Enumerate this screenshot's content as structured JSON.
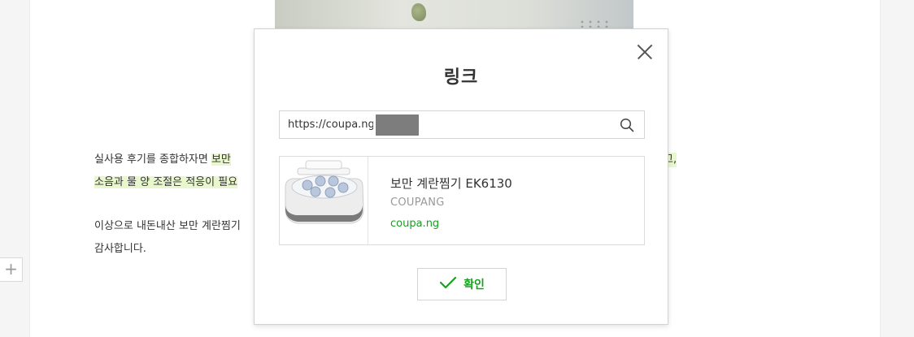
{
  "post": {
    "line1_prefix": "실사용 후기를 종합하자면 ",
    "line1_highlight": "보만 ",
    "line1_suffix_highlight": "고,",
    "line2_highlight": "소음과 물 양 조절은 적응이 필요",
    "line3": "이상으로 내돈내산 보만 계란찜기",
    "line4": "감사합니다."
  },
  "editor": {
    "add_label": "+"
  },
  "link_dialog": {
    "title": "링크",
    "url_value": "https://coupa.ng/",
    "preview": {
      "title": "보만 계란찜기 EK6130",
      "source": "COUPANG",
      "domain": "coupa.ng"
    },
    "confirm_label": "확인"
  },
  "colors": {
    "accent_green": "#17a11f",
    "highlight": "#e9f7cf"
  },
  "icons": [
    "close-icon",
    "search-icon",
    "check-icon",
    "plus-icon"
  ]
}
